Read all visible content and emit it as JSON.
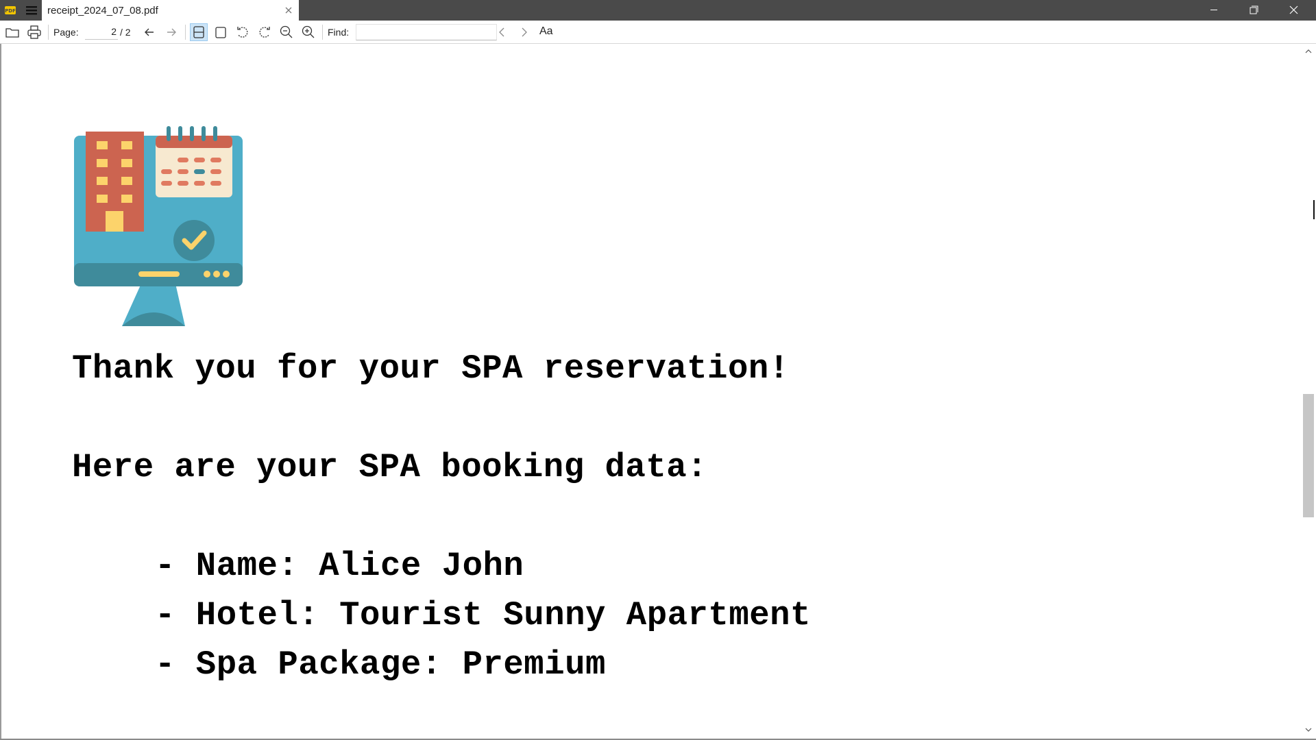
{
  "window": {
    "tab_title": "receipt_2024_07_08.pdf"
  },
  "toolbar": {
    "page_label": "Page:",
    "page_current": "2",
    "page_total": "/ 2",
    "find_label": "Find:",
    "find_value": "",
    "font_toggle_label": "Aa"
  },
  "document": {
    "thank_you": "Thank you for your SPA reservation!",
    "intro": "Here are your SPA booking data:",
    "items": [
      "- Name: Alice John",
      "- Hotel: Tourist Sunny Apartment",
      "- Spa Package: Premium"
    ]
  },
  "icons": {
    "app": "pdf-reader-app-icon",
    "menu": "hamburger-menu-icon",
    "open": "folder-open-icon",
    "print": "printer-icon",
    "prev_page": "arrow-left-icon",
    "next_page": "arrow-right-icon",
    "continuous": "continuous-scroll-icon",
    "single": "single-page-icon",
    "rotate_left": "rotate-left-icon",
    "rotate_right": "rotate-right-icon",
    "zoom_out": "zoom-out-icon",
    "zoom_in": "zoom-in-icon",
    "find_prev": "chevron-left-icon",
    "find_next": "chevron-right-icon",
    "illustration": "hotel-booking-illustration"
  },
  "colors": {
    "titlebar": "#4a4a4a",
    "app_icon_bg": "#f2c500",
    "active_tool": "#cce4f7",
    "illustration_screen": "#4faec8",
    "illustration_base": "#3f8b9b",
    "building": "#cc6450",
    "window_yellow": "#fcd36b",
    "calendar_bg": "#f7e9d0",
    "check_circle": "#3f8b9b"
  }
}
